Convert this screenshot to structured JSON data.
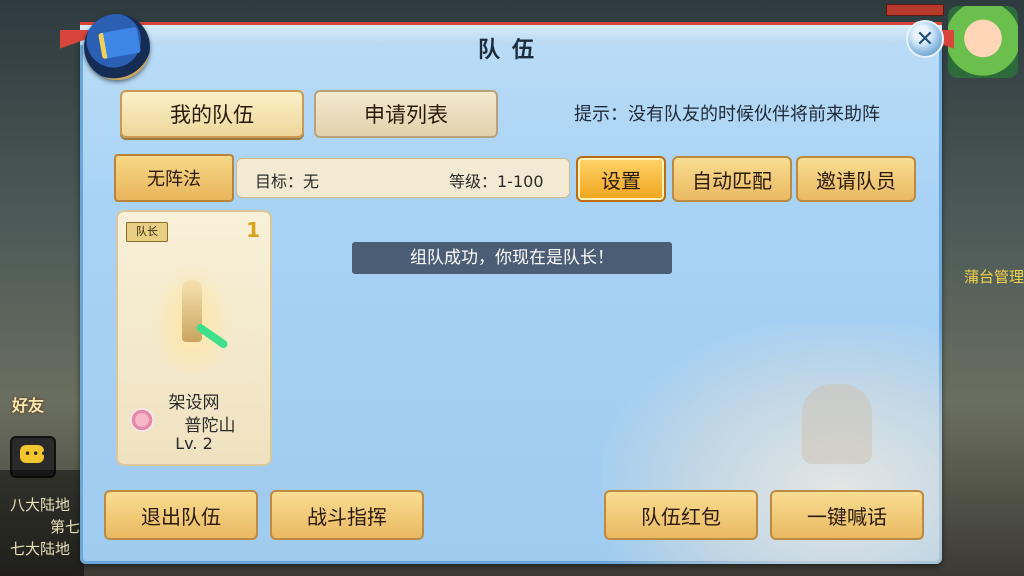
{
  "dialog": {
    "title": "队伍",
    "close_icon": "close-icon",
    "emblem_icon": "team-flag-icon"
  },
  "tabs": [
    {
      "label": "我的队伍",
      "active": true
    },
    {
      "label": "申请列表",
      "active": false
    }
  ],
  "hint": "提示：没有队友的时候伙伴将前来助阵",
  "toolbar": {
    "formation_label": "无阵法",
    "target_text": "目标：无",
    "level_text": "等级：1-100",
    "settings_label": "设置",
    "auto_match_label": "自动匹配",
    "invite_label": "邀请队员"
  },
  "members": [
    {
      "badge": "队长",
      "slot": "1",
      "name": "架设网",
      "school": "普陀山",
      "level": "Lv. 2",
      "school_icon": "lotus-icon"
    }
  ],
  "toast": "组队成功，你现在是队长！",
  "bottom_buttons": {
    "leave": "退出队伍",
    "battle_command": "战斗指挥",
    "red_packet": "队伍红包",
    "shout": "一键喊话"
  },
  "background": {
    "friend_label": "好友",
    "chat_lines": [
      "八大陆地",
      "第七",
      "七大陆地"
    ],
    "right_label": "蒲台管理",
    "chat_icon": "chat-bubble-icon"
  },
  "colors": {
    "panel": "#a9d3f5",
    "gold_button": "#eab962",
    "accent_red": "#d8453a",
    "toast_bg": "#3c4a5e"
  }
}
